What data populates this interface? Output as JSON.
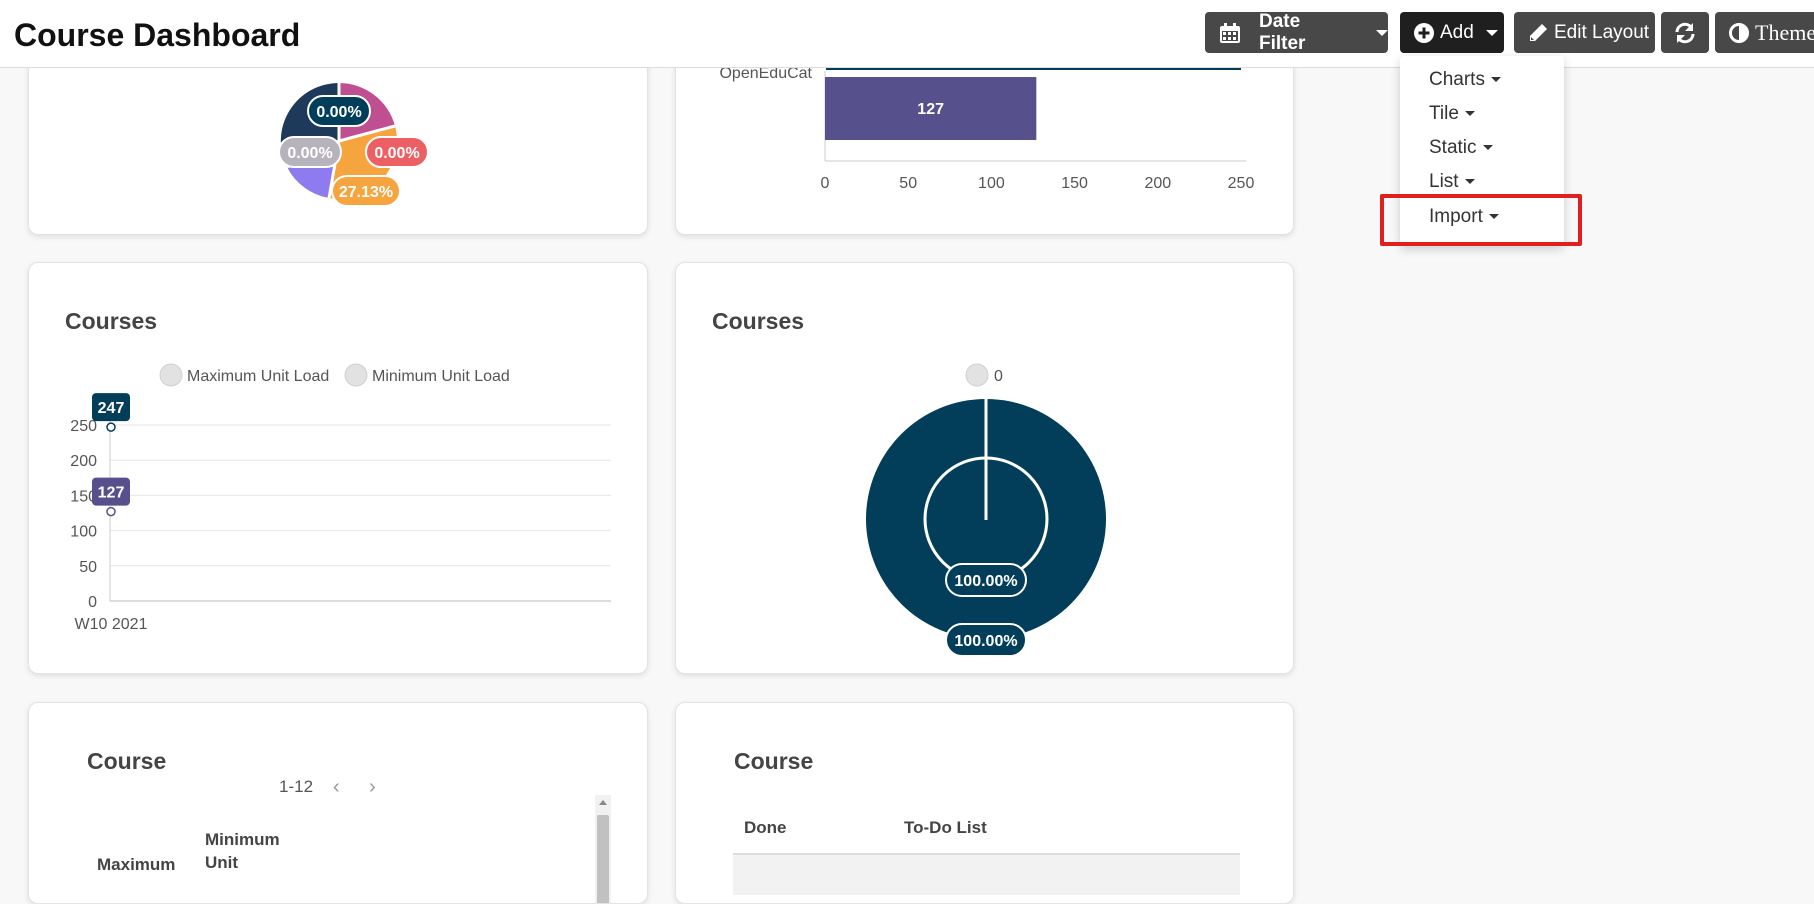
{
  "header": {
    "title": "Course Dashboard",
    "date_filter": "Date Filter",
    "add": "Add",
    "edit_layout": "Edit Layout",
    "theme": "Theme"
  },
  "add_menu": {
    "items": [
      "Charts",
      "Tile",
      "Static",
      "List",
      "Import"
    ],
    "highlighted": "Import"
  },
  "colors": {
    "navy": "#023e5a",
    "purple": "#56508c",
    "pink": "#c04f92",
    "orange": "#f6a43e",
    "coral": "#ec5f62",
    "lavender": "#8e7bf0",
    "gray_label": "#b7b3bd"
  },
  "pie_top": {
    "labels": [
      "0.00%",
      "0.00%",
      "0.00%",
      "27.13%"
    ]
  },
  "bar_top": {
    "category": "OpenEduCat",
    "chart_data": {
      "type": "bar",
      "orientation": "horizontal",
      "categories": [
        "OpenEduCat"
      ],
      "series": [
        {
          "values": [
            127
          ]
        }
      ],
      "xlim": [
        0,
        250
      ],
      "ticks": [
        "0",
        "50",
        "100",
        "150",
        "200",
        "250"
      ]
    }
  },
  "line_card": {
    "title": "Courses",
    "chart_data": {
      "type": "line",
      "x": [
        "W10 2021"
      ],
      "series": [
        {
          "name": "Maximum Unit Load",
          "values": [
            247
          ]
        },
        {
          "name": "Minimum Unit Load",
          "values": [
            127
          ]
        }
      ],
      "ylim": [
        0,
        250
      ],
      "yticks": [
        "0",
        "50",
        "100",
        "150",
        "200",
        "250"
      ],
      "value_labels": [
        "247",
        "127"
      ]
    }
  },
  "donut_card": {
    "title": "Courses",
    "legend": "0",
    "chart_data": {
      "type": "pie",
      "categories": [
        "0"
      ],
      "values": [
        100
      ],
      "labels": [
        "100.00%",
        "100.00%"
      ]
    }
  },
  "list_card": {
    "title": "Course",
    "pager": "1-12",
    "col1": "Minimum",
    "col1b": "Unit",
    "col0": "Maximum"
  },
  "todo_card": {
    "title": "Course",
    "col_done": "Done",
    "col_todo": "To-Do List"
  }
}
